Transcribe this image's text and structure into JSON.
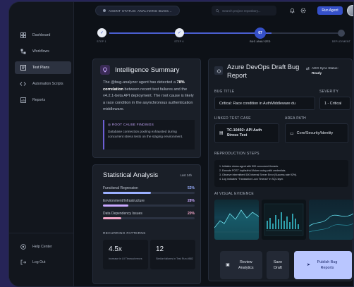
{
  "topbar": {
    "agent_status": "AGENT STATUS: ANALYZING BUGS...",
    "search_placeholder": "Search project repository...",
    "run_agent_label": "Run Agent"
  },
  "sidebar": {
    "items": [
      {
        "label": "Dashboard",
        "icon": "dashboard-icon",
        "active": false
      },
      {
        "label": "Workflows",
        "icon": "workflow-icon",
        "active": false
      },
      {
        "label": "Test Plans",
        "icon": "test-plans-icon",
        "active": true
      },
      {
        "label": "Automation Scripts",
        "icon": "code-icon",
        "active": false
      },
      {
        "label": "Reports",
        "icon": "reports-icon",
        "active": false
      }
    ],
    "help_label": "Help Center",
    "logout_label": "Log Out"
  },
  "stepper": {
    "steps": [
      {
        "label": "STEP 1",
        "state": "done"
      },
      {
        "label": "STEP 6",
        "state": "done"
      },
      {
        "label": "BUG ANALYZED",
        "state": "current",
        "number": "07"
      },
      {
        "label": "DEPLOYMENT",
        "state": "pending"
      }
    ]
  },
  "intelligence": {
    "title": "Intelligence Summary",
    "body_pre": "The @bug-analyzer agent has detected a ",
    "body_bold": "78% correlation",
    "body_post": " between recent test failures and the v4.2.1-beta API deployment. The root cause is likely a race condition in the asynchronous authentication middleware.",
    "findings_heading": "ROOT CAUSE FINDINGS",
    "findings_text": "Database connection pooling exhausted during concurrent stress tests on the staging environment."
  },
  "stats": {
    "title": "Statistical Analysis",
    "range": "Last 24h",
    "rows": [
      {
        "label": "Functional Regression",
        "pct": "52%",
        "value": 0.52,
        "color": "#9bb0ff"
      },
      {
        "label": "Environment/Infrastructure",
        "pct": "28%",
        "value": 0.28,
        "color": "#c9a8ff"
      },
      {
        "label": "Data Dependency Issues",
        "pct": "20%",
        "value": 0.2,
        "color": "#f3a6c8"
      }
    ],
    "recurring_label": "RECURRING PATTERNS",
    "patterns": [
      {
        "value": "4.5x",
        "desc": "Increase in UI Timeout errors"
      },
      {
        "value": "12",
        "desc": "Similar failures in Test Run #882"
      }
    ]
  },
  "bug_report": {
    "title": "Azure DevOps Draft Bug Report",
    "sync_label": "ADO Sync Status:",
    "sync_status": "Ready",
    "bug_title_label": "BUG TITLE",
    "bug_title_value": "Critical: Race condition in AuthMiddleware du",
    "severity_label": "SEVERITY",
    "severity_value": "1 - Critical",
    "linked_label": "LINKED TEST CASE",
    "linked_value_1": "TC-10492: API Auth",
    "linked_value_2": "Stress Test",
    "area_label": "AREA PATH",
    "area_value": "Core/Security/Identity",
    "repro_label": "REPRODUCTION STEPS",
    "repro_steps": [
      "1. Initialize stress-agent with 500 concurrent threads.",
      "2. Execute POST /api/auth/v1/token using valid credentials.",
      "3. Observe intermittent 500 Internal Server Error (Success rate 92%).",
      "4. Log indicates \"Transaction Lock Timeout\" in SQL layer."
    ],
    "evidence_label": "AI VISUAL EVIDENCE",
    "actions": {
      "review": "Review Analytics",
      "save": "Save Draft",
      "publish": "Publish Bug Reports"
    }
  }
}
